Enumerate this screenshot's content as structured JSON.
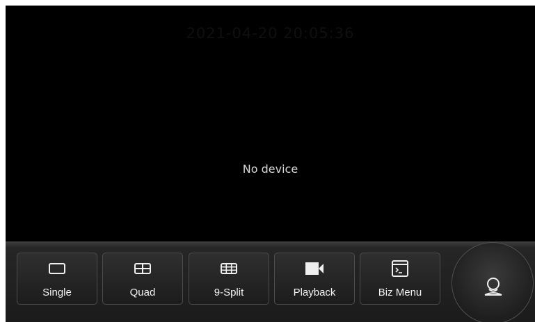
{
  "screen": {
    "timestamp": "2021-04-20 20:05:36",
    "status_message": "No device"
  },
  "toolbar": {
    "buttons": [
      {
        "label": "Single",
        "icon": "single-view-icon"
      },
      {
        "label": "Quad",
        "icon": "quad-view-icon"
      },
      {
        "label": "9-Split",
        "icon": "nine-split-view-icon"
      },
      {
        "label": "Playback",
        "icon": "video-camera-icon"
      },
      {
        "label": "Biz Menu",
        "icon": "terminal-window-icon"
      }
    ],
    "side_button_icon": "user-icon"
  },
  "colors": {
    "background": "#000000",
    "toolbar": "#1b1b1b",
    "button_border": "#4d4d4d",
    "text": "#f2f2f2"
  }
}
